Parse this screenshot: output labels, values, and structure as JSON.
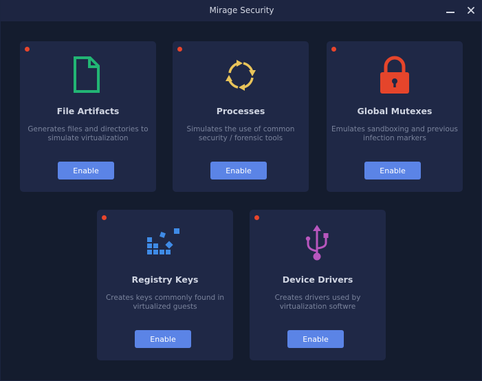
{
  "window": {
    "title": "Mirage Security"
  },
  "colors": {
    "background": "#141c2e",
    "card": "#1f2846",
    "accent_button": "#5b84e6",
    "status_dot": "#e8452c"
  },
  "cards": [
    {
      "title": "File Artifacts",
      "description": "Generates files and directories to simulate virtualization",
      "button": "Enable",
      "icon": "file-icon",
      "icon_color": "#22b574"
    },
    {
      "title": "Processes",
      "description": "Simulates the use of common security / forensic tools",
      "button": "Enable",
      "icon": "refresh-arrows-icon",
      "icon_color": "#e9c45a"
    },
    {
      "title": "Global Mutexes",
      "description": "Emulates sandboxing and previous infection markers",
      "button": "Enable",
      "icon": "lock-icon",
      "icon_color": "#e5452b"
    },
    {
      "title": "Registry Keys",
      "description": "Creates keys commonly found in virtualized guests",
      "button": "Enable",
      "icon": "registry-icon",
      "icon_color": "#3f8be6"
    },
    {
      "title": "Device Drivers",
      "description": "Creates drivers used by virtualization softwre",
      "button": "Enable",
      "icon": "usb-icon",
      "icon_color": "#b856be"
    }
  ]
}
